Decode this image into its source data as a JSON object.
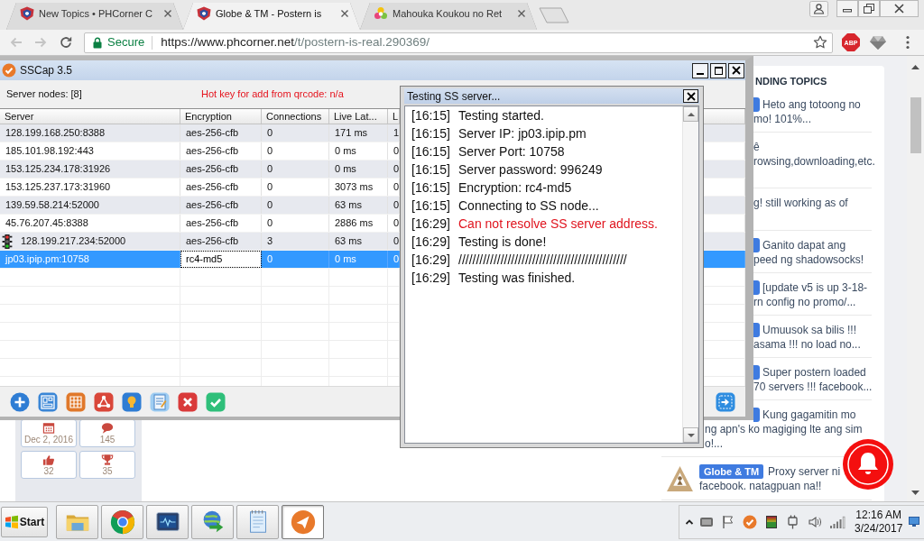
{
  "browser": {
    "tabs": [
      {
        "kind": "shield",
        "title": "New Topics • PHCorner C",
        "selected": false
      },
      {
        "kind": "shield",
        "title": "Globe & TM - Postern is",
        "selected": true
      },
      {
        "kind": "flower",
        "title": "Mahouka Koukou no Ret",
        "selected": false
      }
    ],
    "address_bar": {
      "secure_label": "Secure",
      "url_origin": "https://www.phcorner.net",
      "url_path": "/t/postern-is-real.290369/"
    },
    "extension_label": "ABP"
  },
  "page": {
    "stats": [
      {
        "kind": "date",
        "value": "Dec 2, 2016"
      },
      {
        "kind": "replies",
        "value": "145"
      },
      {
        "kind": "likes",
        "value": "32"
      },
      {
        "kind": "points",
        "value": "35"
      }
    ],
    "trending": {
      "heading": "NDING TOPICS",
      "items": [
        {
          "kind": "cut-tag",
          "lines": [
            "Heto ang totoong no",
            "mo! 101%..."
          ]
        },
        {
          "kind": "plain",
          "lines": [
            "ê",
            "rowsing,downloading,etc."
          ]
        },
        {
          "kind": "plain",
          "lines": [
            "g! still working as of"
          ]
        },
        {
          "kind": "cut-tag",
          "lines": [
            "Ganito dapat ang",
            "peed ng shadowsocks!"
          ]
        },
        {
          "kind": "cut-tag",
          "lines": [
            "[update v5 is up 3-18-",
            "rn config no promo/..."
          ]
        },
        {
          "kind": "cut-tag",
          "lines": [
            "Umuusok sa bilis !!!",
            "asama !!! no load no..."
          ]
        },
        {
          "kind": "cut-tag",
          "lines": [
            "Super postern loaded",
            "70 servers !!! facebook..."
          ]
        },
        {
          "kind": "cut-tag",
          "lines": [
            "Kung gagamitin mo",
            "ng apn's ko magiging lte ang sim",
            "o!..."
          ]
        },
        {
          "kind": "full",
          "tag": "Globe & TM",
          "lines": [
            "Proxy server ni",
            "facebook. natagpuan na!!"
          ]
        }
      ]
    }
  },
  "sscap": {
    "title": "SSCap 3.5",
    "server_nodes": "Server nodes: [8]",
    "hotkey_notice": "Hot key for add from qrcode: n/a",
    "table": {
      "columns": [
        "Server",
        "Encryption",
        "Connections",
        "Live Lat...",
        "L"
      ],
      "rows": [
        {
          "server": "128.199.168.250:8388",
          "encryption": "aes-256-cfb",
          "connections": "0",
          "latency": "171 ms",
          "column_5": "1",
          "selected": false,
          "connected": false
        },
        {
          "server": "185.101.98.192:443",
          "encryption": "aes-256-cfb",
          "connections": "0",
          "latency": "0 ms",
          "column_5": "0",
          "selected": false,
          "connected": false
        },
        {
          "server": "153.125.234.178:31926",
          "encryption": "aes-256-cfb",
          "connections": "0",
          "latency": "0 ms",
          "column_5": "0",
          "selected": false,
          "connected": false
        },
        {
          "server": "153.125.237.173:31960",
          "encryption": "aes-256-cfb",
          "connections": "0",
          "latency": "3073 ms",
          "column_5": "0",
          "selected": false,
          "connected": false
        },
        {
          "server": "139.59.58.214:52000",
          "encryption": "aes-256-cfb",
          "connections": "0",
          "latency": "63 ms",
          "column_5": "0",
          "selected": false,
          "connected": false
        },
        {
          "server": "45.76.207.45:8388",
          "encryption": "aes-256-cfb",
          "connections": "0",
          "latency": "2886 ms",
          "column_5": "0",
          "selected": false,
          "connected": false
        },
        {
          "server": "128.199.217.234:52000",
          "encryption": "aes-256-cfb",
          "connections": "3",
          "latency": "63 ms",
          "column_5": "0",
          "selected": false,
          "connected": true
        },
        {
          "server": "jp03.ipip.pm:10758",
          "encryption": "rc4-md5",
          "connections": "0",
          "latency": "0 ms",
          "column_5": "0",
          "selected": true,
          "connected": false
        }
      ]
    }
  },
  "test_dialog": {
    "title": "Testing SS server...",
    "log": [
      {
        "time": "[16:15]",
        "message": "Testing started.",
        "kind": "info"
      },
      {
        "time": "[16:15]",
        "message": "Server IP: jp03.ipip.pm",
        "kind": "info"
      },
      {
        "time": "[16:15]",
        "message": "Server Port: 10758",
        "kind": "info"
      },
      {
        "time": "[16:15]",
        "message": "Server password: 996249",
        "kind": "info"
      },
      {
        "time": "[16:15]",
        "message": "Encryption: rc4-md5",
        "kind": "info"
      },
      {
        "time": "[16:15]",
        "message": "Connecting to SS node...",
        "kind": "info"
      },
      {
        "time": "[16:29]",
        "message": "Can not resolve SS server address.",
        "kind": "error"
      },
      {
        "time": "[16:29]",
        "message": "Testing is done!",
        "kind": "info"
      },
      {
        "time": "[16:29]",
        "message": "////////////////////////////////////////////////",
        "kind": "info"
      },
      {
        "time": "[16:29]",
        "message": "Testing was finished.",
        "kind": "info"
      }
    ]
  },
  "taskbar": {
    "start_label": "Start",
    "apps": [
      {
        "kind": "folder",
        "active": false
      },
      {
        "kind": "ring",
        "active": false
      },
      {
        "kind": "monitor",
        "active": false
      },
      {
        "kind": "globe",
        "active": false
      },
      {
        "kind": "notepad",
        "active": false
      },
      {
        "kind": "plane",
        "active": true
      }
    ],
    "clock": {
      "time": "12:16 AM",
      "date": "3/24/2017"
    }
  }
}
